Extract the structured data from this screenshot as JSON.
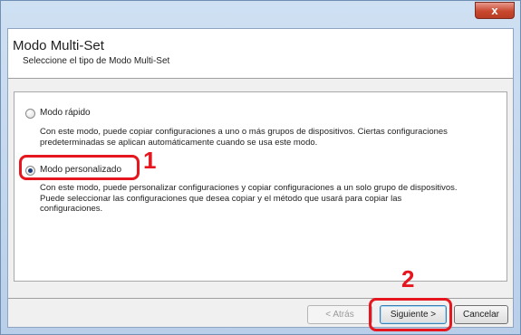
{
  "window": {
    "title": "",
    "close_glyph": "x"
  },
  "header": {
    "title": "Modo Multi-Set",
    "subtitle": "Seleccione el tipo de Modo Multi-Set"
  },
  "options": [
    {
      "label": "Modo rápido",
      "selected": false,
      "description_lines": [
        "Con este modo, puede copiar configuraciones a uno o más grupos de dispositivos. Ciertas configuraciones",
        "predeterminadas se aplican automáticamente cuando se usa este modo."
      ]
    },
    {
      "label": "Modo personalizado",
      "selected": true,
      "description_lines": [
        "Con este modo, puede personalizar configuraciones y copiar configuraciones a un solo grupo de dispositivos.",
        "Puede seleccionar las configuraciones que desea copiar y el método que usará para copiar las",
        "configuraciones."
      ]
    }
  ],
  "annotations": {
    "step1": "1",
    "step2": "2",
    "highlight_color": "#e5161e"
  },
  "buttons": {
    "back": "< Atrás",
    "next": "Siguiente >",
    "cancel": "Cancelar"
  }
}
